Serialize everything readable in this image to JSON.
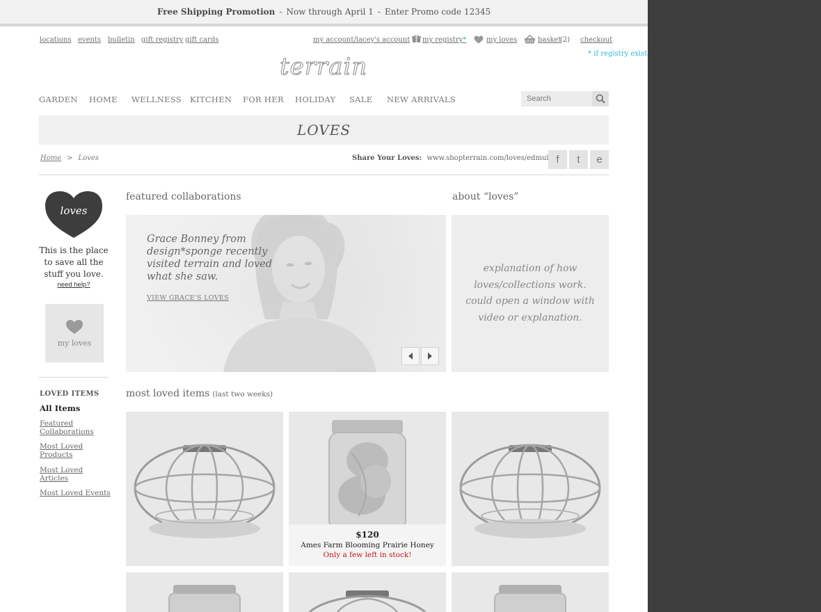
{
  "promo": {
    "title": "Free Shipping Promotion",
    "sep1": "-",
    "dates": "Now through April 1",
    "sep2": "-",
    "code": "Enter Promo code 12345"
  },
  "utility_nav": {
    "left": [
      "locations",
      "events",
      "bulletin",
      "gift registry",
      "gift cards"
    ],
    "account": "my account/lacey's account",
    "registry": "my registry",
    "registry_star": "*",
    "loves": "my loves",
    "basket": "basket",
    "basket_count": "(2)",
    "checkout": "checkout",
    "registry_note": "* if registry exists"
  },
  "logo": "terrain",
  "main_nav": [
    "GARDEN",
    "HOME",
    "WELLNESS",
    "KITCHEN",
    "FOR HER",
    "HOLIDAY",
    "SALE",
    "NEW ARRIVALS"
  ],
  "search": {
    "placeholder": "Search"
  },
  "page_title": "LOVES",
  "breadcrumb": {
    "home": "Home",
    "separator": ">",
    "current": "Loves"
  },
  "share": {
    "label": "Share Your Loves:",
    "url": "www.shopterrain.com/loves/edmullen",
    "buttons": [
      "f",
      "t",
      "e"
    ]
  },
  "sidebar": {
    "badge": "loves",
    "intro": "This is the place to save all the stuff you love.",
    "help": "need help?",
    "my_loves": "my loves",
    "heading": "LOVED ITEMS",
    "all_items": "All Items",
    "links": [
      "Featured Collaborations",
      "Most Loved Products",
      "Most Loved Articles",
      "Most Loved Events"
    ]
  },
  "featured": {
    "title": "featured collaborations",
    "quote": "Grace Bonney from design*sponge recently visited terrain and loved what she saw.",
    "cta": "VIEW GRACE'S LOVES"
  },
  "about": {
    "title": "about “loves”",
    "text": "explanation of how loves/collections work. could open a window with video or explanation."
  },
  "most_loved": {
    "title": "most loved items",
    "subtitle": "(last two weeks)",
    "product": {
      "price": "$120",
      "name": "Ames Farm Blooming Prairie Honey",
      "stock": "Only a few left in stock!"
    }
  },
  "colors": {
    "right_panel": "#3e3e3e",
    "stock_alert": "#c0141b",
    "registry_note": "#2fb6d6"
  }
}
